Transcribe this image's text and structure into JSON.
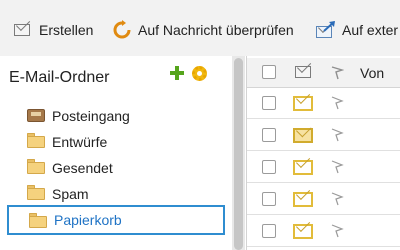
{
  "toolbar": {
    "buttons": [
      {
        "label": "Erstellen",
        "icon": "envelope-icon"
      },
      {
        "label": "Auf Nachricht überprüfen",
        "icon": "refresh-icon"
      },
      {
        "label": "Auf exter",
        "icon": "send-icon"
      }
    ]
  },
  "sidebar": {
    "title": "E-Mail-Ordner",
    "actions": [
      {
        "icon": "add-folder-icon",
        "color": "#55a51c"
      },
      {
        "icon": "settings-icon",
        "color": "#f1b80f"
      }
    ],
    "folders": [
      {
        "label": "Posteingang",
        "icon": "inbox-icon",
        "selected": false
      },
      {
        "label": "Entwürfe",
        "icon": "folder-icon",
        "selected": false
      },
      {
        "label": "Gesendet",
        "icon": "folder-icon",
        "selected": false
      },
      {
        "label": "Spam",
        "icon": "folder-icon",
        "selected": false
      },
      {
        "label": "Papierkorb",
        "icon": "folder-icon",
        "selected": true
      }
    ]
  },
  "mail_list": {
    "columns": [
      {
        "name": "select-all",
        "label": ""
      },
      {
        "name": "read-status",
        "label": ""
      },
      {
        "name": "flag",
        "label": ""
      },
      {
        "name": "from",
        "label": "Von"
      }
    ],
    "rows": [
      {
        "status": "unread",
        "flagged": false
      },
      {
        "status": "read",
        "flagged": false
      },
      {
        "status": "unread",
        "flagged": false
      },
      {
        "status": "unread",
        "flagged": false
      },
      {
        "status": "unread",
        "flagged": false
      }
    ]
  },
  "colors": {
    "selected_border": "#2f8dd0",
    "selected_text": "#1f73c5",
    "toolbar_bg": "#f2f2f2"
  }
}
